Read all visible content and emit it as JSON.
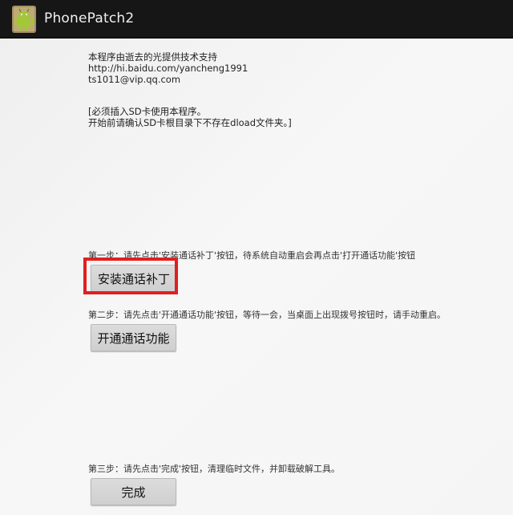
{
  "app": {
    "title": "PhonePatch2"
  },
  "info": {
    "line1": "本程序由逝去的光提供技术支持",
    "line2": "http://hi.baidu.com/yancheng1991",
    "line3": "ts1011@vip.qq.com"
  },
  "notice": {
    "line1": "[必须插入SD卡使用本程序。",
    "line2": "开始前请确认SD卡根目录下不存在dload文件夹。]"
  },
  "steps": [
    {
      "text": "第一步：请先点击'安装通话补丁'按钮，待系统自动重启会再点击'打开通话功能'按钮",
      "button": "安装通话补丁"
    },
    {
      "text": "第二步：请先点击'开通通话功能'按钮，等待一会，当桌面上出现拨号按钮时，请手动重启。",
      "button": "开通通话功能"
    },
    {
      "text": "第三步：请先点击'完成'按钮，清理临时文件，并卸载破解工具。",
      "button": "完成"
    }
  ],
  "colors": {
    "title_bar": "#161616",
    "highlight": "#e01f1f",
    "android_green": "#a4c639"
  }
}
